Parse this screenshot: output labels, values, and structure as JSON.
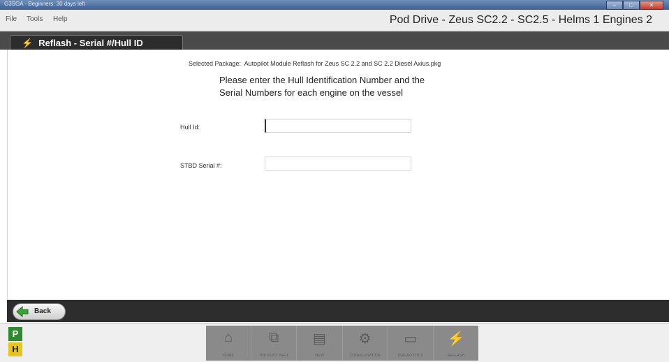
{
  "window": {
    "title": "G3SGA - Beginners: 30 days left",
    "controls": [
      "–",
      "□",
      "✕"
    ]
  },
  "menu": {
    "items": [
      "File",
      "Tools",
      "Help"
    ],
    "app_title": "Pod Drive - Zeus SC2.2 - SC2.5 - Helms 1 Engines 2"
  },
  "step": {
    "icon": "lightning-bolt-icon",
    "title": "Reflash - Serial #/Hull ID"
  },
  "content": {
    "package_label": "Selected Package:",
    "package_name": "Autopilot Module Reflash for Zeus SC 2.2 and SC 2.2 Diesel Axius.pkg",
    "instruction_line1": "Please enter the Hull Identification Number and the",
    "instruction_line2": "Serial Numbers for each engine on the vessel",
    "fields": [
      {
        "label": "Hull Id:",
        "value": ""
      },
      {
        "label": "STBD Serial #:",
        "value": ""
      }
    ]
  },
  "nav": {
    "back_label": "Back"
  },
  "footer": {
    "indicators": [
      "P",
      "H"
    ],
    "toolbar": [
      {
        "label": "HOME",
        "icon": "home-icon"
      },
      {
        "label": "PRODUCT INFO",
        "icon": "product-info-icon"
      },
      {
        "label": "VIEW",
        "icon": "view-icon"
      },
      {
        "label": "CONFIGURATION",
        "icon": "configuration-icon"
      },
      {
        "label": "DIAGNOSTICS",
        "icon": "diagnostics-icon"
      },
      {
        "label": "REFLASH",
        "icon": "reflash-icon"
      }
    ]
  }
}
